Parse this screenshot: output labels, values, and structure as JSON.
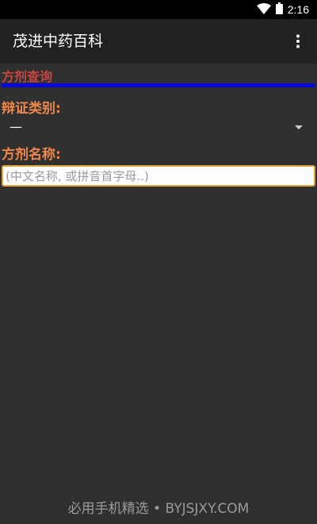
{
  "status_bar": {
    "time": "2:16"
  },
  "app_bar": {
    "title": "茂进中药百科"
  },
  "section": {
    "label": "方剂查询"
  },
  "category": {
    "label": "辩证类别:",
    "selected": "—"
  },
  "formula_name": {
    "label": "方剂名称:",
    "placeholder": "(中文名称, 或拼音首字母..)"
  },
  "watermark": {
    "text": "必用手机精选 • BYJSJXY.COM"
  },
  "colors": {
    "section_label": "#c8453f",
    "field_label": "#f0874a",
    "rule": "#0a0adc",
    "input_border": "#e6a33b",
    "app_bar": "#212121",
    "background": "#303030"
  }
}
